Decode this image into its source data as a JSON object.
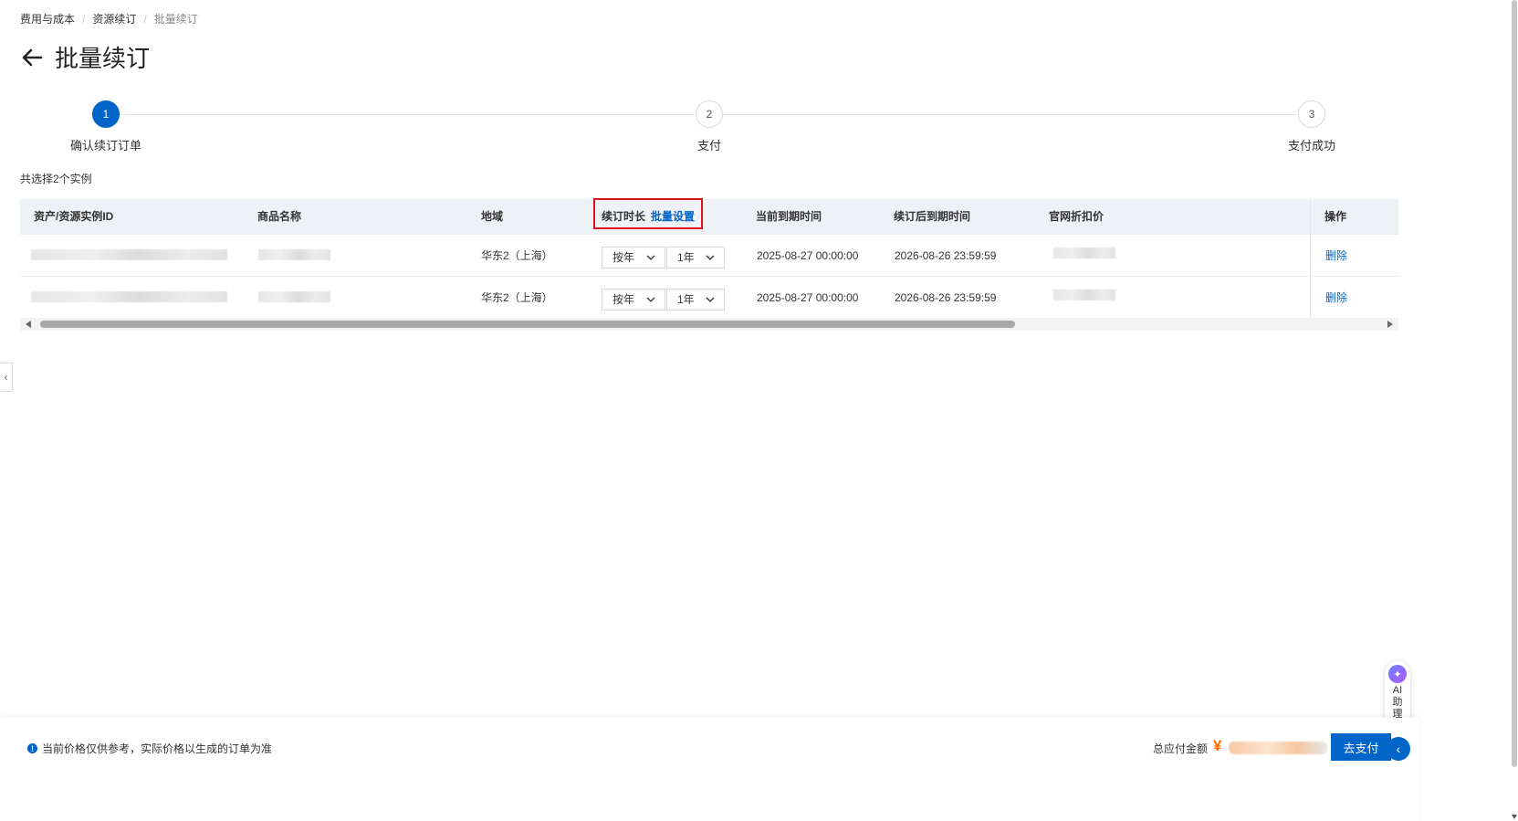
{
  "breadcrumb": {
    "items": [
      "费用与成本",
      "资源续订",
      "批量续订"
    ]
  },
  "page": {
    "title": "批量续订"
  },
  "steps": [
    {
      "number": "1",
      "label": "确认续订订单",
      "active": true
    },
    {
      "number": "2",
      "label": "支付",
      "active": false
    },
    {
      "number": "3",
      "label": "支付成功",
      "active": false
    }
  ],
  "selection": {
    "summary": "共选择2个实例"
  },
  "table": {
    "headers": {
      "asset_id": "资产/资源实例ID",
      "product_name": "商品名称",
      "region": "地域",
      "duration": "续订时长",
      "batch_setting": "批量设置",
      "current_expiry": "当前到期时间",
      "renewed_expiry": "续订后到期时间",
      "discount_price": "官网折扣价",
      "actions": "操作"
    },
    "rows": [
      {
        "region": "华东2（上海）",
        "period_unit": "按年",
        "period_value": "1年",
        "current_expiry": "2025-08-27 00:00:00",
        "renewed_expiry": "2026-08-26 23:59:59",
        "action": "删除"
      },
      {
        "region": "华东2（上海）",
        "period_unit": "按年",
        "period_value": "1年",
        "current_expiry": "2025-08-27 00:00:00",
        "renewed_expiry": "2026-08-26 23:59:59",
        "action": "删除"
      }
    ]
  },
  "assistant": {
    "label": "AI助理"
  },
  "footer": {
    "notice": "当前价格仅供参考，实际价格以生成的订单为准",
    "total_label": "总应付金额",
    "currency_symbol": "¥",
    "pay_button": "去支付"
  },
  "colors": {
    "primary": "#0064c8",
    "highlight_border": "#e0111b",
    "price": "#ff6a00"
  }
}
